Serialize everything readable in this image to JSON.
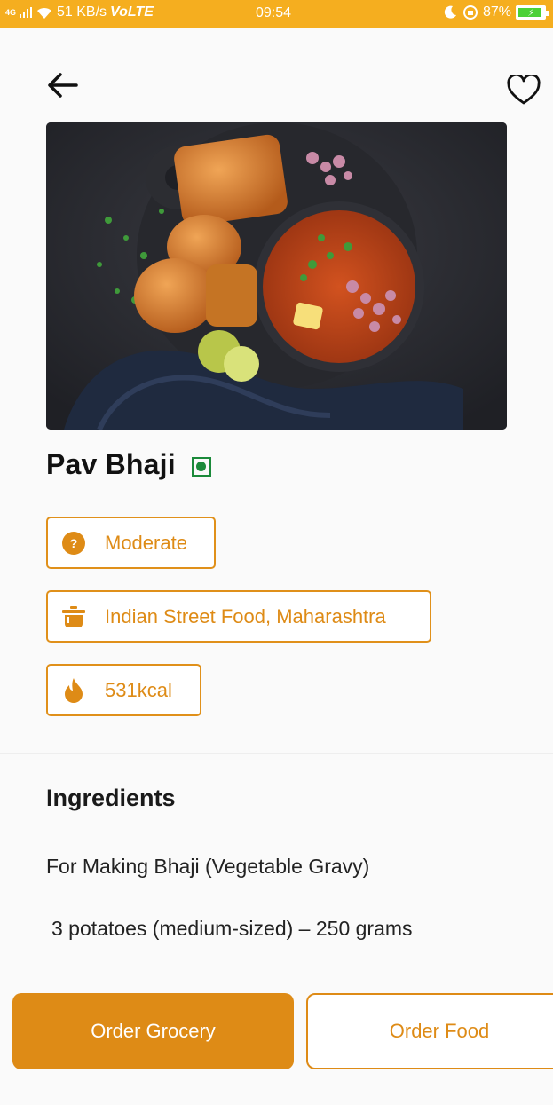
{
  "status_bar": {
    "network": "4G",
    "speed": "51 KB/s",
    "volte": "VoLTE",
    "time": "09:54",
    "battery": "87%"
  },
  "header": {
    "back_icon": "arrow-left-icon",
    "favorite_icon": "heart-outline-icon"
  },
  "recipe": {
    "title": "Pav Bhaji",
    "veg_icon": "veg-mark-icon",
    "tags": [
      {
        "icon": "help-circle-icon",
        "label": "Moderate"
      },
      {
        "icon": "pot-icon",
        "label": "Indian Street Food, Maharashtra"
      },
      {
        "icon": "flame-icon",
        "label": "531kcal"
      }
    ]
  },
  "ingredients": {
    "title": "Ingredients",
    "subtitle": "For Making Bhaji (Vegetable Gravy)",
    "items": [
      "3 potatoes (medium-sized) – 250 grams"
    ]
  },
  "actions": {
    "order_grocery": "Order Grocery",
    "order_food": "Order Food"
  },
  "colors": {
    "accent": "#de8b16",
    "status_bar": "#f5ae1f",
    "veg_green": "#1b8a3a"
  }
}
